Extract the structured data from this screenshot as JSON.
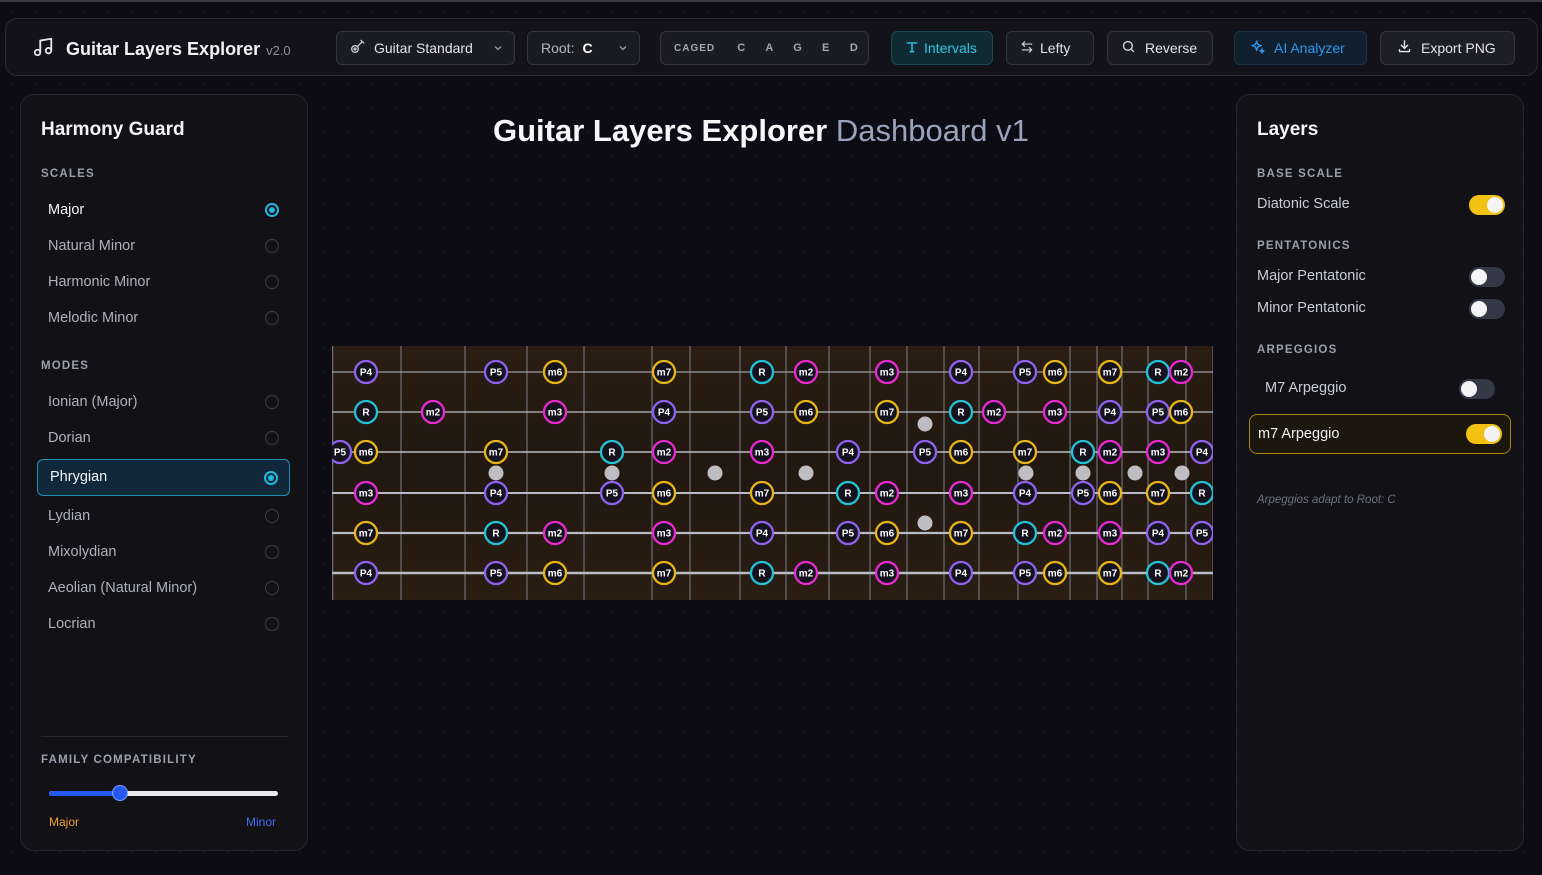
{
  "header": {
    "app_title": "Guitar Layers Explorer",
    "version": "v2.0",
    "tuning": "Guitar Standard",
    "root_label": "Root:",
    "root_value": "C",
    "caged_label": "CAGED",
    "caged_shapes": [
      "C",
      "A",
      "G",
      "E",
      "D"
    ],
    "intervals_label": "Intervals",
    "lefty_label": "Lefty",
    "reverse_label": "Reverse",
    "ai_label": "AI Analyzer",
    "export_label": "Export PNG"
  },
  "harmony": {
    "title": "Harmony Guard",
    "scales_heading": "SCALES",
    "scales": [
      {
        "label": "Major",
        "selected": true
      },
      {
        "label": "Natural Minor",
        "selected": false
      },
      {
        "label": "Harmonic Minor",
        "selected": false
      },
      {
        "label": "Melodic Minor",
        "selected": false
      }
    ],
    "modes_heading": "MODES",
    "modes": [
      {
        "label": "Ionian (Major)",
        "selected": false
      },
      {
        "label": "Dorian",
        "selected": false
      },
      {
        "label": "Phrygian",
        "selected": true
      },
      {
        "label": "Lydian",
        "selected": false
      },
      {
        "label": "Mixolydian",
        "selected": false
      },
      {
        "label": "Aeolian (Natural Minor)",
        "selected": false
      },
      {
        "label": "Locrian",
        "selected": false
      }
    ],
    "family_heading": "FAMILY COMPATIBILITY",
    "family_value": 0.31,
    "family_left": "Major",
    "family_right": "Minor"
  },
  "main": {
    "title": "Guitar Layers Explorer",
    "subtitle": "Dashboard v1"
  },
  "layers": {
    "title": "Layers",
    "base_heading": "BASE SCALE",
    "base": [
      {
        "label": "Diatonic Scale",
        "on": true
      }
    ],
    "pent_heading": "PENTATONICS",
    "pent": [
      {
        "label": "Major Pentatonic",
        "on": false
      },
      {
        "label": "Minor Pentatonic",
        "on": false
      }
    ],
    "arp_heading": "ARPEGGIOS",
    "arp": [
      {
        "label": "M7 Arpeggio",
        "on": false
      },
      {
        "label": "m7 Arpeggio",
        "on": true
      }
    ],
    "note": "Arpeggios adapt to Root: C"
  },
  "colors": {
    "accent": "#22b6e0",
    "toggle_on": "#f2c111",
    "R": "#22c3d6",
    "P4": "#8f62f0",
    "P5": "#8f62f0",
    "m2": "#e82ad0",
    "m3": "#e82ad0",
    "m6": "#e8b614",
    "m7": "#e8b614"
  },
  "fretboard": {
    "strings": [
      {
        "notes": [
          "P4",
          "P5",
          "m6",
          "m7",
          "R",
          "m2",
          "m3",
          "P4",
          "P5",
          "m6",
          "m7",
          "R",
          "m2"
        ]
      },
      {
        "notes": [
          "R",
          "m2",
          "m3",
          "P4",
          "P5",
          "m6",
          "m7",
          "R",
          "m2",
          "m3",
          "P4",
          "P5",
          "m6"
        ]
      },
      {
        "notes": [
          "P5",
          "m6",
          "m7",
          "R",
          "m2",
          "m3",
          "P4",
          "P5",
          "m6",
          "m7",
          "R",
          "m2",
          "m3",
          "P4"
        ]
      },
      {
        "notes": [
          "m3",
          "P4",
          "P5",
          "m6",
          "m7",
          "R",
          "m2",
          "m3",
          "P4",
          "P5",
          "m6",
          "m7",
          "R"
        ]
      },
      {
        "notes": [
          "m7",
          "R",
          "m2",
          "m3",
          "P4",
          "P5",
          "m6",
          "m7",
          "R",
          "m2",
          "m3",
          "P4",
          "P5"
        ]
      },
      {
        "notes": [
          "P4",
          "P5",
          "m6",
          "m7",
          "R",
          "m2",
          "m3",
          "P4",
          "P5",
          "m6",
          "m7",
          "R",
          "m2"
        ]
      }
    ]
  }
}
